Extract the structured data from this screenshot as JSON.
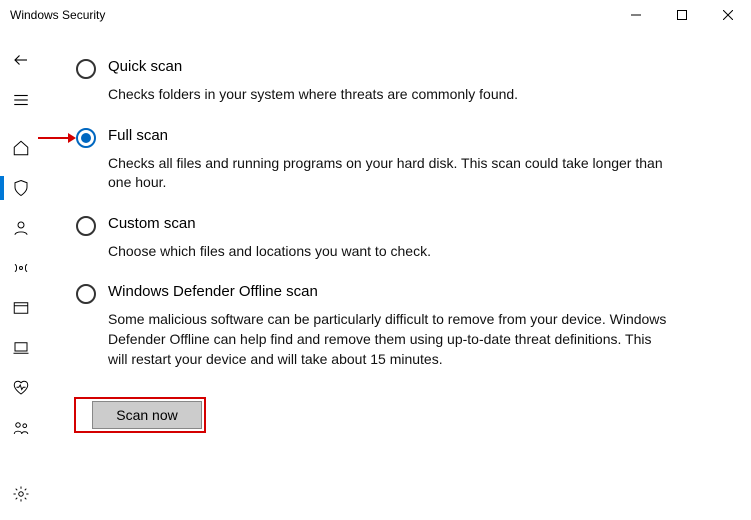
{
  "window": {
    "title": "Windows Security"
  },
  "options": {
    "quick": {
      "label": "Quick scan",
      "desc": "Checks folders in your system where threats are commonly found."
    },
    "full": {
      "label": "Full scan",
      "desc": "Checks all files and running programs on your hard disk. This scan could take longer than one hour."
    },
    "custom": {
      "label": "Custom scan",
      "desc": "Choose which files and locations you want to check."
    },
    "offline": {
      "label": "Windows Defender Offline scan",
      "desc": "Some malicious software can be particularly difficult to remove from your device. Windows Defender Offline can help find and remove them using up-to-date threat definitions. This will restart your device and will take about 15 minutes."
    }
  },
  "action": {
    "scan_now": "Scan now"
  }
}
